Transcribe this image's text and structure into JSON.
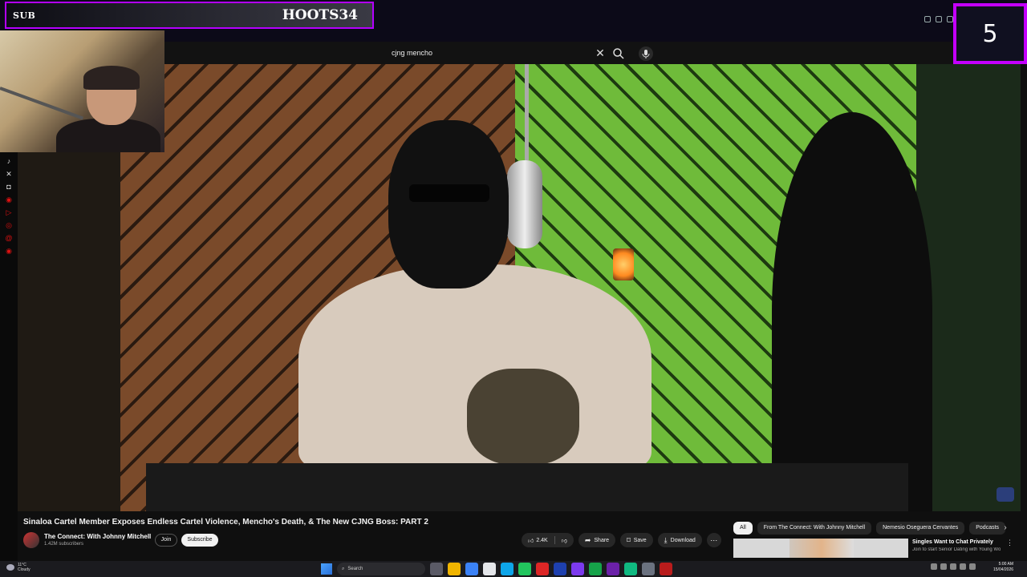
{
  "overlay": {
    "banner_left": "SUB",
    "banner_name": "HOOTS34",
    "counter": "5"
  },
  "search": {
    "value": "cjng mencho"
  },
  "video": {
    "title": "Sinaloa Cartel Member Exposes Endless Cartel Violence, Mencho's Death, & The New CJNG Boss: PART 2",
    "channel": "The Connect: With Johnny Mitchell",
    "subscribers": "1.42M subscribers",
    "join_label": "Join",
    "subscribe_label": "Subscribe",
    "likes": "2.4K",
    "share_label": "Share",
    "save_label": "Save",
    "download_label": "Download"
  },
  "chips": [
    {
      "label": "All",
      "active": true
    },
    {
      "label": "From The Connect: With Johnny Mitchell"
    },
    {
      "label": "Nemesio Oseguera Cervantes"
    },
    {
      "label": "Podcasts"
    }
  ],
  "recommendation": {
    "title": "Singles Want to Chat Privately",
    "description": "Join to start Senior Dating with Young Women. Age is nothing. Join, have fun!"
  },
  "taskbar": {
    "weather_temp": "11°C",
    "weather_desc": "Cloudy",
    "search_label": "Search",
    "time": "5:00 AM",
    "date": "15/04/2026"
  },
  "social_icons": [
    "tiktok-icon",
    "x-icon",
    "discord-icon",
    "youtube-icon",
    "play-icon",
    "instagram-icon",
    "threads-icon",
    "circle-icon"
  ]
}
